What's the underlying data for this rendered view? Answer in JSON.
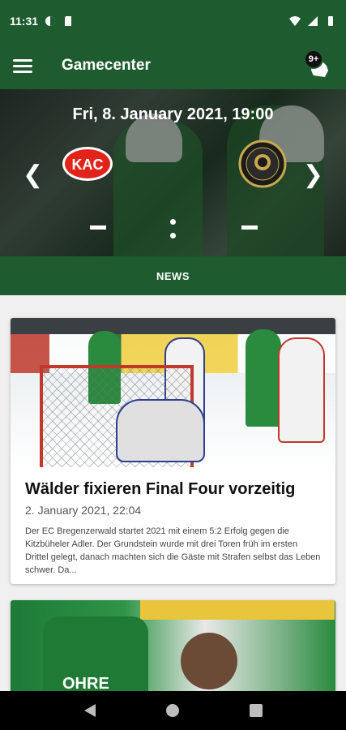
{
  "status_bar": {
    "time": "11:31"
  },
  "app_bar": {
    "title": "Gamecenter",
    "notification_count": "9+"
  },
  "game": {
    "date": "Fri, 8. January 2021, 19:00",
    "home_team_logo": "KAC",
    "away_team_logo_icon": "ec-bregenzerwald-crest",
    "home_score": "-",
    "away_score": "-"
  },
  "tabs": {
    "active": "NEWS"
  },
  "news": [
    {
      "title": "Wälder fixieren Final Four vorzeitig",
      "date": "2. January 2021, 22:04",
      "excerpt": "Der EC Bregenzerwald startet 2021 mit einem 5:2 Erfolg gegen die Kitzbüheler Adler. Der Grundstein wurde mit drei Toren früh im ersten Drittel gelegt, danach machten sich die Gäste mit Strafen selbst das Leben schwer. Da..."
    },
    {
      "image_text": "OHRE"
    }
  ],
  "colors": {
    "primary": "#1e5b2e",
    "kac_red": "#e2231a"
  }
}
